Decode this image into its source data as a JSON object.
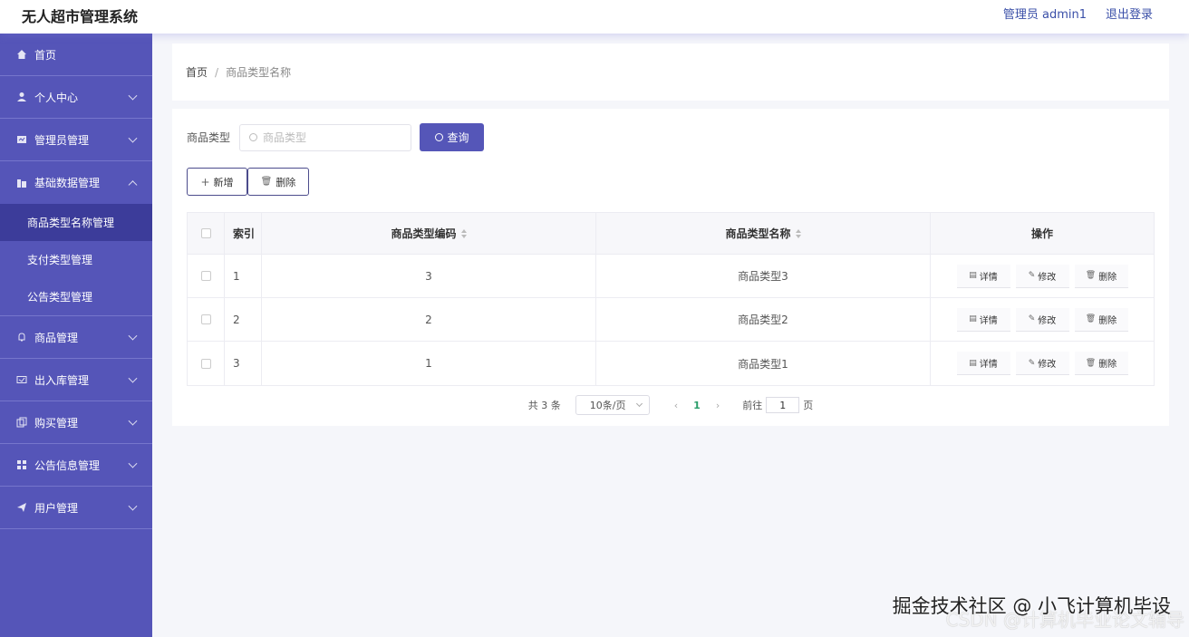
{
  "header": {
    "app_title": "无人超市管理系统",
    "user": "管理员 admin1",
    "logout": "退出登录"
  },
  "sidebar": {
    "items": [
      {
        "label": "首页",
        "icon": "home-icon",
        "expandable": false
      },
      {
        "label": "个人中心",
        "icon": "user-icon",
        "expandable": true
      },
      {
        "label": "管理员管理",
        "icon": "admin-icon",
        "expandable": true
      },
      {
        "label": "基础数据管理",
        "icon": "data-icon",
        "expandable": true,
        "expanded": true,
        "children": [
          "商品类型名称管理",
          "支付类型管理",
          "公告类型管理"
        ],
        "active_child": 0
      },
      {
        "label": "商品管理",
        "icon": "bell-icon",
        "expandable": true
      },
      {
        "label": "出入库管理",
        "icon": "inout-icon",
        "expandable": true
      },
      {
        "label": "购买管理",
        "icon": "copy-icon",
        "expandable": true
      },
      {
        "label": "公告信息管理",
        "icon": "grid-icon",
        "expandable": true
      },
      {
        "label": "用户管理",
        "icon": "send-icon",
        "expandable": true
      }
    ]
  },
  "breadcrumb": {
    "home": "首页",
    "separator": "/",
    "current": "商品类型名称"
  },
  "search": {
    "label": "商品类型",
    "placeholder": "商品类型",
    "query_button": "查询"
  },
  "actions": {
    "add": "新增",
    "delete": "删除"
  },
  "table": {
    "headers": {
      "index": "索引",
      "code": "商品类型编码",
      "name": "商品类型名称",
      "ops": "操作"
    },
    "rows": [
      {
        "index": "1",
        "code": "3",
        "name": "商品类型3"
      },
      {
        "index": "2",
        "code": "2",
        "name": "商品类型2"
      },
      {
        "index": "3",
        "code": "1",
        "name": "商品类型1"
      }
    ],
    "op_labels": {
      "detail": "详情",
      "edit": "修改",
      "delete": "删除"
    }
  },
  "pagination": {
    "total": "共 3 条",
    "page_size": "10条/页",
    "prev": "‹",
    "current_page": "1",
    "next": "›",
    "goto_label": "前往",
    "goto_value": "1",
    "page_suffix": "页"
  },
  "watermark": {
    "line1": "掘金技术社区 @ 小飞计算机毕设",
    "line2": "CSDN @计算机毕业论文辅导"
  },
  "colors": {
    "sidebar": "#5555b8",
    "sidebar_active": "#3c3c9a",
    "primary_button": "#5556b8",
    "page_number": "#2a9d6a"
  }
}
